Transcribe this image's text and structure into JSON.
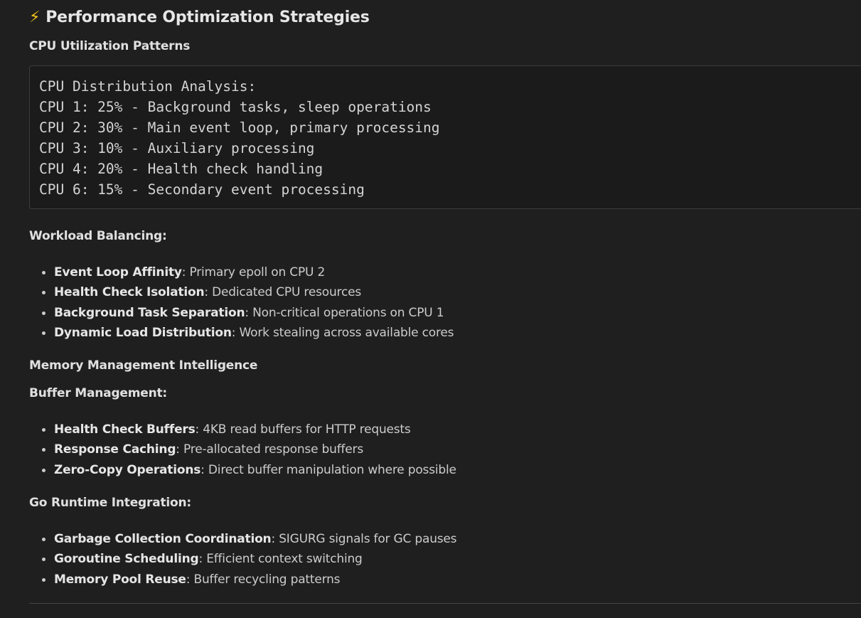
{
  "heading": {
    "icon": "⚡",
    "title": "Performance Optimization Strategies"
  },
  "cpu_section": {
    "title": "CPU Utilization Patterns",
    "code_lines": [
      "CPU Distribution Analysis:",
      "CPU 1: 25% - Background tasks, sleep operations",
      "CPU 2: 30% - Main event loop, primary processing",
      "CPU 3: 10% - Auxiliary processing",
      "CPU 4: 20% - Health check handling",
      "CPU 6: 15% - Secondary event processing"
    ]
  },
  "workload": {
    "title": "Workload Balancing:",
    "items": [
      {
        "term": "Event Loop Affinity",
        "desc": ": Primary epoll on CPU 2"
      },
      {
        "term": "Health Check Isolation",
        "desc": ": Dedicated CPU resources"
      },
      {
        "term": "Background Task Separation",
        "desc": ": Non-critical operations on CPU 1"
      },
      {
        "term": "Dynamic Load Distribution",
        "desc": ": Work stealing across available cores"
      }
    ]
  },
  "memory": {
    "title": "Memory Management Intelligence"
  },
  "buffer": {
    "title": "Buffer Management:",
    "items": [
      {
        "term": "Health Check Buffers",
        "desc": ": 4KB read buffers for HTTP requests"
      },
      {
        "term": "Response Caching",
        "desc": ": Pre-allocated response buffers"
      },
      {
        "term": "Zero-Copy Operations",
        "desc": ": Direct buffer manipulation where possible"
      }
    ]
  },
  "go_runtime": {
    "title": "Go Runtime Integration:",
    "items": [
      {
        "term": "Garbage Collection Coordination",
        "desc": ": SIGURG signals for GC pauses"
      },
      {
        "term": "Goroutine Scheduling",
        "desc": ": Efficient context switching"
      },
      {
        "term": "Memory Pool Reuse",
        "desc": ": Buffer recycling patterns"
      }
    ]
  },
  "colors": {
    "background": "#1f1f1f",
    "text": "#cccccc",
    "heading": "#e6e6e6",
    "accent_bolt": "#f5c518"
  }
}
